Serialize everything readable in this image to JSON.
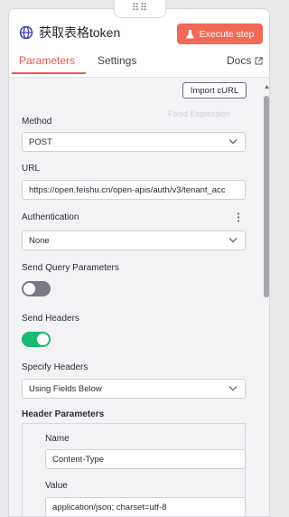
{
  "drag_handle": {
    "glyph": "⠿⠿"
  },
  "header": {
    "title": "获取表格token",
    "execute_label": "Execute step",
    "node_icon": "globe-icon",
    "execute_icon": "flask-icon"
  },
  "tabs": {
    "parameters": "Parameters",
    "settings": "Settings",
    "docs": "Docs",
    "docs_icon": "external-link-icon",
    "active": "parameters"
  },
  "import_curl": "Import cURL",
  "ghost_hint": "Fixed  Expression",
  "method": {
    "label": "Method",
    "value": "POST"
  },
  "url": {
    "label": "URL",
    "value": "https://open.feishu.cn/open-apis/auth/v3/tenant_acc"
  },
  "authentication": {
    "label": "Authentication",
    "value": "None"
  },
  "send_query": {
    "label": "Send Query Parameters",
    "enabled": false
  },
  "send_headers": {
    "label": "Send Headers",
    "enabled": true
  },
  "specify_headers": {
    "label": "Specify Headers",
    "value": "Using Fields Below"
  },
  "header_parameters": {
    "label": "Header Parameters",
    "name_label": "Name",
    "name_value": "Content-Type",
    "value_label": "Value",
    "value_value": "application/json; charset=utf-8"
  },
  "colors": {
    "accent": "#e8574a",
    "execute_bg": "#f06a56",
    "toggle_on": "#1db972",
    "toggle_off": "#7a7a85"
  }
}
